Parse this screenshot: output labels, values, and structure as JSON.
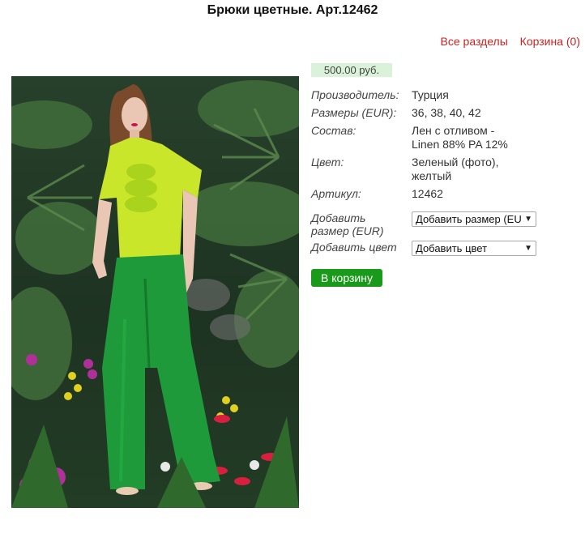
{
  "page": {
    "title": "Брюки цветные. Арт.12462"
  },
  "nav": {
    "all_sections": "Все разделы",
    "cart": "Корзина (0)"
  },
  "product": {
    "price": "500.00 руб.",
    "properties": [
      {
        "label": "Производитель:",
        "value": "Турция"
      },
      {
        "label": "Размеры (EUR):",
        "value": "36, 38, 40, 42"
      },
      {
        "label": "Состав:",
        "value": "Лен с отливом - Linen 88% PA 12%"
      },
      {
        "label": "Цвет:",
        "value": "Зеленый (фото), желтый"
      },
      {
        "label": "Артикул:",
        "value": "12462"
      }
    ],
    "add_size": {
      "label": "Добавить размер (EUR)",
      "selected": "Добавить размер (EUR)"
    },
    "add_color": {
      "label": "Добавить цвет",
      "selected": "Добавить цвет"
    },
    "cart_button": "В корзину"
  },
  "colors": {
    "link": "#cc2222",
    "button": "#1a9a1a",
    "price_bg": "#d9f2d9"
  },
  "icons": {
    "dropdown": "chevron-down-icon"
  }
}
